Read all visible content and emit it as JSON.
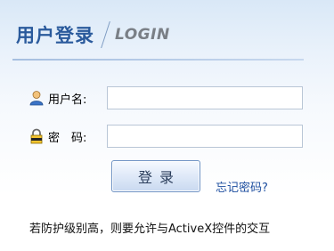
{
  "header": {
    "title_cn": "用户登录",
    "title_en": "LOGIN"
  },
  "form": {
    "username_label": "用户名:",
    "username_value": "",
    "password_label": "密　码:",
    "password_value": "",
    "login_button": "登录",
    "forgot_link": "忘记密码?"
  },
  "notice": "若防护级别高，则要允许与ActiveX控件的交互",
  "icons": {
    "username": "user-icon",
    "password": "lock-icon"
  },
  "colors": {
    "title": "#2a5a9c",
    "link": "#1f4fa0",
    "subtitle": "#7a7f86"
  }
}
